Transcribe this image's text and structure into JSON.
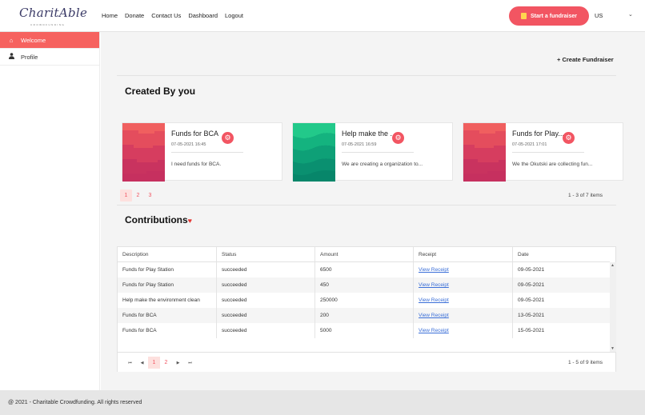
{
  "brand": {
    "logo_text": "CharitAble",
    "logo_sub": "CROWDFUNDING"
  },
  "nav": {
    "items": [
      "Home",
      "Donate",
      "Contact Us",
      "Dashboard",
      "Logout"
    ]
  },
  "header": {
    "cta_label": "Start a fundraiser",
    "locale": "US",
    "chevron": "⌄"
  },
  "sidebar": {
    "items": [
      {
        "label": "Welcome",
        "icon": "home-icon",
        "glyph": "⌂",
        "active": true
      },
      {
        "label": "Profile",
        "icon": "user-icon",
        "glyph": "👤",
        "active": false
      }
    ]
  },
  "main": {
    "create_fundraiser": "+ Create Fundraiser",
    "created_title": "Created By you",
    "contributions_title": "Contributions",
    "heart": "♥"
  },
  "cards": [
    {
      "title": "Funds for BCA",
      "date": "07-05-2021 16:45",
      "desc": "I need funds for BCA.",
      "theme": "red"
    },
    {
      "title": "Help make the ...",
      "date": "07-05-2021 16:59",
      "desc": "We are creating a organization to...",
      "theme": "green"
    },
    {
      "title": "Funds for Play...",
      "date": "07-05-2021 17:01",
      "desc": "We the Okutski are collecting fun...",
      "theme": "red"
    }
  ],
  "cards_pager": {
    "pages": [
      "1",
      "2",
      "3"
    ],
    "range": "1 - 3 of 7 items"
  },
  "table": {
    "headers": [
      "Description",
      "Status",
      "Amount",
      "Receipt",
      "Date"
    ],
    "rows": [
      [
        "Funds for Play Station",
        "succeeded",
        "6500",
        "View Receipt",
        "09-05-2021"
      ],
      [
        "Funds for Play Station",
        "succeeded",
        "450",
        "View Receipt",
        "09-05-2021"
      ],
      [
        "Help make the environment clean",
        "succeeded",
        "250000",
        "View Receipt",
        "09-05-2021"
      ],
      [
        "Funds for BCA",
        "succeeded",
        "200",
        "View Receipt",
        "13-05-2021"
      ],
      [
        "Funds for BCA",
        "succeeded",
        "5000",
        "View Receipt",
        "15-05-2021"
      ]
    ],
    "pager": {
      "first": "⏮",
      "prev": "◀",
      "pages": [
        "1",
        "2"
      ],
      "next": "▶",
      "last": "⏭",
      "range": "1 - 5 of 9 items"
    }
  },
  "footer": {
    "text": "@ 2021 - Charitable Crowdfunding. All rights reserved"
  },
  "colors": {
    "accent": "#f25562",
    "sidebar_active": "#f6625f",
    "link": "#3b6fd8"
  }
}
